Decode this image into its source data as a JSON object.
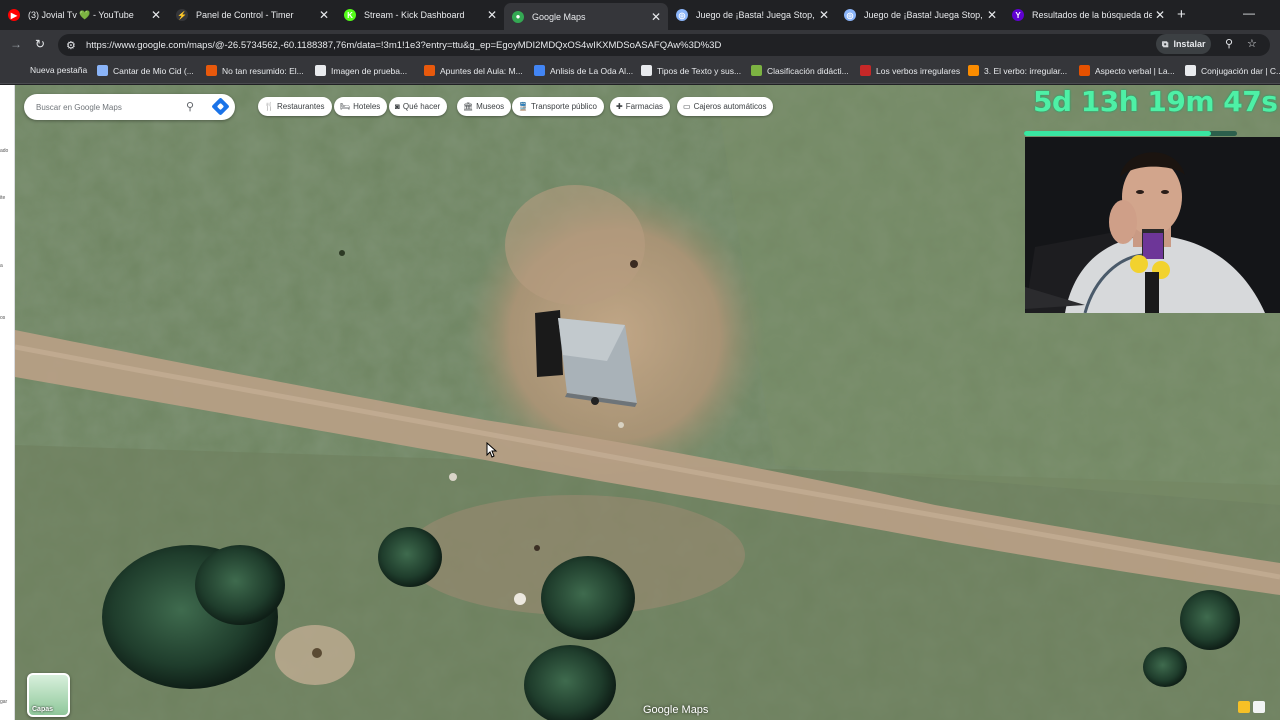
{
  "tabs": [
    {
      "title": "(3) Jovial Tv 💚 - YouTube",
      "icon": "youtube-icon",
      "color": "#ff0000",
      "glyph": "▶",
      "active": false
    },
    {
      "title": "Panel de Control - Timer",
      "icon": "timer-icon",
      "color": "#35363a",
      "glyph": "⚡",
      "active": false
    },
    {
      "title": "Stream - Kick Dashboard",
      "icon": "kick-icon",
      "color": "#53fc18",
      "glyph": "K",
      "active": false
    },
    {
      "title": "Google Maps",
      "icon": "maps-icon",
      "color": "#34a853",
      "glyph": "●",
      "active": true
    },
    {
      "title": "Juego de ¡Basta! Juega Stop, Tu…",
      "icon": "globe-icon",
      "color": "#8ab4f8",
      "glyph": "◎",
      "active": false
    },
    {
      "title": "Juego de ¡Basta! Juega Stop, Tu…",
      "icon": "globe-icon",
      "color": "#8ab4f8",
      "glyph": "◎",
      "active": false
    },
    {
      "title": "Resultados de la búsqueda de …",
      "icon": "yahoo-icon",
      "color": "#6001d2",
      "glyph": "Y",
      "active": false
    }
  ],
  "toolbar": {
    "url": "https://www.google.com/maps/@-26.5734562,-60.1188387,76m/data=!3m1!1e3?entry=ttu&g_ep=EgoyMDI2MDQxOS4wIKXMDSoASAFQAw%3D%3D",
    "install_label": "Instalar"
  },
  "bookmarks": [
    {
      "label": "Nueva pestaña",
      "color": ""
    },
    {
      "label": "Cantar de Mio Cid (...",
      "color": "#8ab4f8"
    },
    {
      "label": "No tan resumido: El...",
      "color": "#e8590c"
    },
    {
      "label": "Imagen de prueba...",
      "color": "#e8eaed"
    },
    {
      "label": "Apuntes del Aula: M...",
      "color": "#e8590c"
    },
    {
      "label": "Anlisis de La Oda Al...",
      "color": "#4285f4"
    },
    {
      "label": "Tipos de Texto y sus...",
      "color": "#e8eaed"
    },
    {
      "label": "Clasificación didácti...",
      "color": "#7cb342"
    },
    {
      "label": "Los verbos irregulares",
      "color": "#c62828"
    },
    {
      "label": "3. El verbo: irregular...",
      "color": "#fb8c00"
    },
    {
      "label": "Aspecto verbal | La...",
      "color": "#e65100"
    },
    {
      "label": "Conjugación dar | C...",
      "color": "#e8eaed"
    }
  ],
  "map": {
    "search_placeholder": "Buscar en Google Maps",
    "chips": [
      {
        "label": "Restaurantes",
        "icon": "restaurant-icon",
        "glyph": "🍴"
      },
      {
        "label": "Hoteles",
        "icon": "hotel-icon",
        "glyph": "🛏"
      },
      {
        "label": "Qué hacer",
        "icon": "camera-icon",
        "glyph": "◙"
      },
      {
        "label": "Museos",
        "icon": "museum-icon",
        "glyph": "🏛"
      },
      {
        "label": "Transporte público",
        "icon": "transit-icon",
        "glyph": "🚆"
      },
      {
        "label": "Farmacias",
        "icon": "pharmacy-icon",
        "glyph": "✚"
      },
      {
        "label": "Cajeros automáticos",
        "icon": "atm-icon",
        "glyph": "▭"
      }
    ],
    "layers_label": "Capas",
    "logo": "Google Maps"
  },
  "overlay": {
    "timer": "5d 13h 19m 47s",
    "progress_fraction": 0.88,
    "timer_color": "#4ef0a6"
  },
  "left_strip": [
    "ado",
    "ite",
    "a",
    "os",
    "gar"
  ]
}
